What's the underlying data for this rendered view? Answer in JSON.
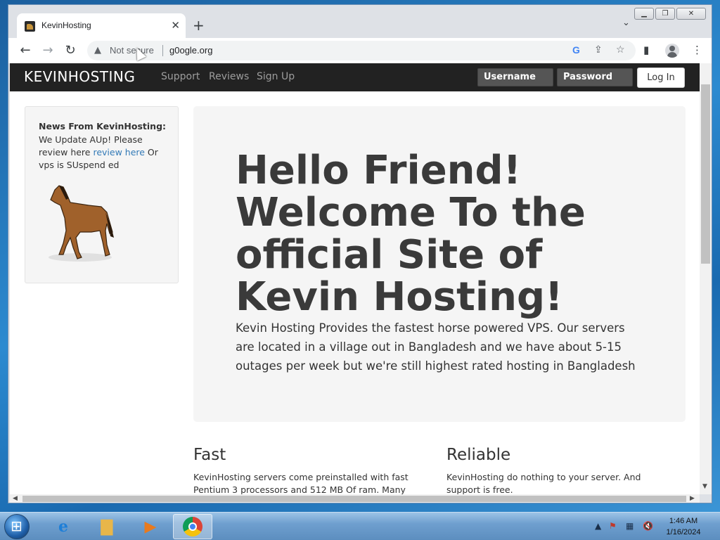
{
  "browser": {
    "tab_title": "KevinHosting",
    "address_security": "Not secure",
    "url": "g0ogle.org"
  },
  "site": {
    "brand": "KEVINHOSTING",
    "nav": [
      "Support",
      "Reviews",
      "Sign Up"
    ],
    "username_placeholder": "Username",
    "password_placeholder": "Password",
    "login_label": "Log In",
    "news": {
      "title": "News From KevinHosting:",
      "body_prefix": "We Update AUp! Please review here ",
      "link_text": "review here",
      "body_suffix": " Or vps is SUspend ed"
    },
    "hero": {
      "heading": "Hello Friend! Welcome To the official Site of Kevin Hosting!",
      "text": "Kevin Hosting Provides the fastest horse powered VPS. Our servers are located in a village out in Bangladesh and we have about 5-15 outages per week but we're still highest rated hosting in Bangladesh"
    },
    "features": [
      {
        "title": "Fast",
        "text": "KevinHosting servers come preinstalled with fast Pentium 3 processors and 512 MB Of ram. Many"
      },
      {
        "title": "Reliable",
        "text": "KevinHosting do nothing to your server. And support is free."
      }
    ]
  },
  "taskbar": {
    "time": "1:46 AM",
    "date": "1/16/2024"
  },
  "colors": {
    "navbar": "#222222",
    "link": "#337ab7",
    "jumbotron": "#f5f5f5"
  }
}
